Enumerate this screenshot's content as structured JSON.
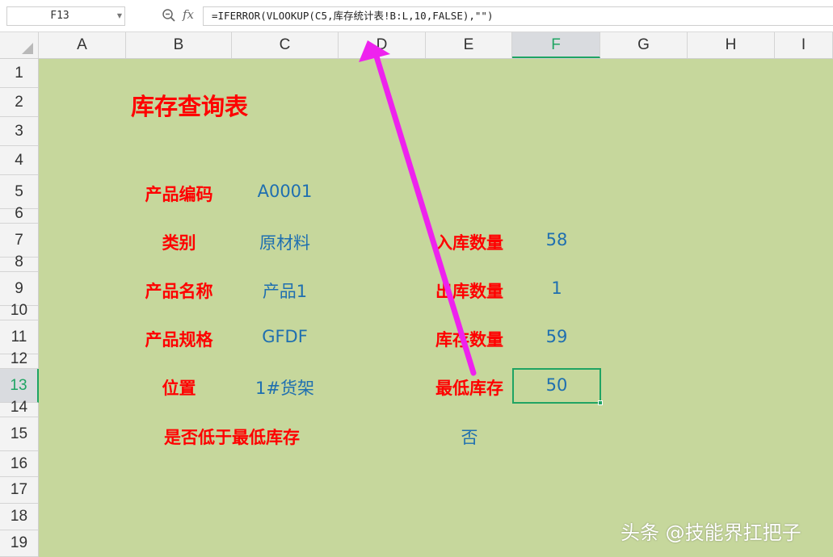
{
  "formula_bar": {
    "name_box": "F13",
    "fx_label": "fx",
    "formula": "=IFERROR(VLOOKUP(C5,库存统计表!B:L,10,FALSE),\"\")"
  },
  "columns": [
    "A",
    "B",
    "C",
    "D",
    "E",
    "F",
    "G",
    "H",
    "I"
  ],
  "rows": [
    "1",
    "2",
    "3",
    "4",
    "5",
    "6",
    "7",
    "8",
    "9",
    "10",
    "11",
    "12",
    "13",
    "14",
    "15",
    "16",
    "17",
    "18",
    "19"
  ],
  "active_cell": {
    "column": "F",
    "row": "13"
  },
  "sheet": {
    "title": "库存查询表",
    "left_fields": [
      {
        "label": "产品编码",
        "value": "A0001"
      },
      {
        "label": "类别",
        "value": "原材料"
      },
      {
        "label": "产品名称",
        "value": "产品1"
      },
      {
        "label": "产品规格",
        "value": "GFDF"
      },
      {
        "label": "位置",
        "value": "1#货架"
      }
    ],
    "right_fields": [
      {
        "label": "入库数量",
        "value": "58"
      },
      {
        "label": "出库数量",
        "value": "1"
      },
      {
        "label": "库存数量",
        "value": "59"
      },
      {
        "label": "最低库存",
        "value": "50"
      }
    ],
    "below_min_label": "是否低于最低库存",
    "below_min_value": "否"
  },
  "watermark": "头条 @技能界扛把子",
  "colors": {
    "sheet_bg": "#c6d79c",
    "label_red": "#ff0000",
    "value_blue": "#1f6fb0",
    "selection_green": "#1fa463",
    "arrow_magenta": "#ee22ee"
  }
}
